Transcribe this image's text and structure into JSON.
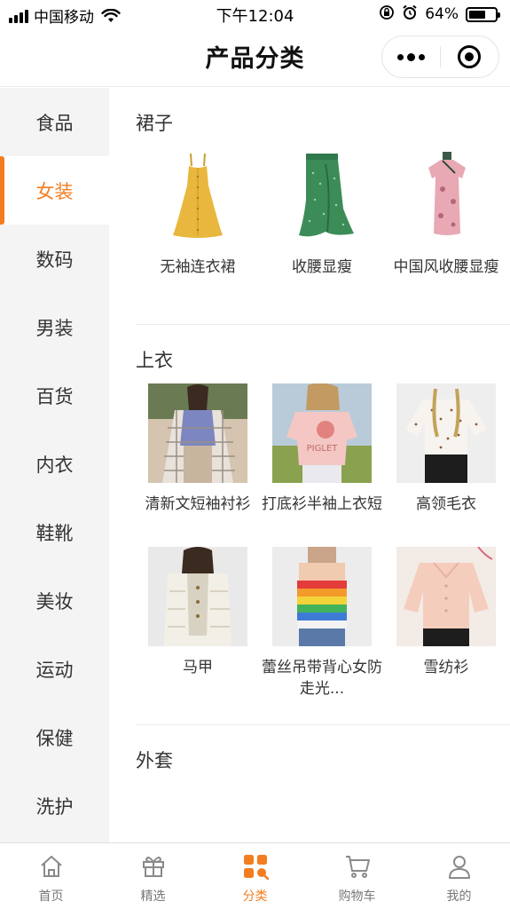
{
  "status_bar": {
    "carrier": "中国移动",
    "time": "下午12:04",
    "battery_pct": "64%",
    "battery_level": 0.64
  },
  "nav": {
    "title": "产品分类",
    "capsule_icons": [
      "more-dots-icon",
      "close-circle-icon"
    ]
  },
  "sidebar": {
    "items": [
      {
        "label": "食品"
      },
      {
        "label": "女装"
      },
      {
        "label": "数码"
      },
      {
        "label": "男装"
      },
      {
        "label": "百货"
      },
      {
        "label": "内衣"
      },
      {
        "label": "鞋靴"
      },
      {
        "label": "美妆"
      },
      {
        "label": "运动"
      },
      {
        "label": "保健"
      },
      {
        "label": "洗护"
      }
    ],
    "active_index": 1
  },
  "sections": [
    {
      "title": "裙子",
      "products": [
        {
          "name": "无袖连衣裙"
        },
        {
          "name": "收腰显瘦"
        },
        {
          "name": "中国风收腰显瘦"
        }
      ]
    },
    {
      "title": "上衣",
      "products": [
        {
          "name": "清新文短袖衬衫"
        },
        {
          "name": "打底衫半袖上衣短"
        },
        {
          "name": "高领毛衣"
        },
        {
          "name": "马甲"
        },
        {
          "name": "蕾丝吊带背心女防走光..."
        },
        {
          "name": "雪纺衫"
        }
      ]
    },
    {
      "title": "外套",
      "products": []
    }
  ],
  "tab_bar": {
    "items": [
      {
        "label": "首页",
        "icon": "home-icon"
      },
      {
        "label": "精选",
        "icon": "gift-icon"
      },
      {
        "label": "分类",
        "icon": "category-grid-icon"
      },
      {
        "label": "购物车",
        "icon": "cart-icon"
      },
      {
        "label": "我的",
        "icon": "user-icon"
      }
    ],
    "active_index": 2
  },
  "colors": {
    "accent": "#f37d1f",
    "sidebar_bg": "#f4f4f4",
    "text": "#333333"
  }
}
